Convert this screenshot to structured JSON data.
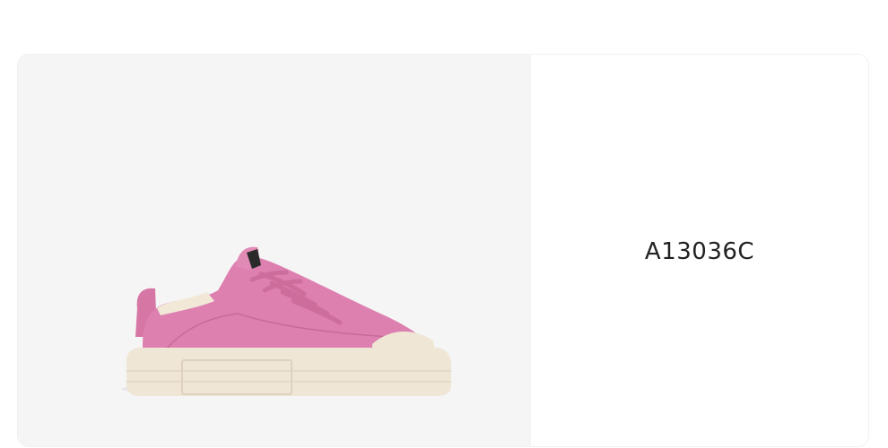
{
  "product": {
    "image_name": "pink-platform-sneaker",
    "sku": "A13036C"
  },
  "colors": {
    "panel_bg": "#f5f5f5",
    "upper": "#dd7fae",
    "sole": "#efe6d6",
    "text": "#222222"
  }
}
